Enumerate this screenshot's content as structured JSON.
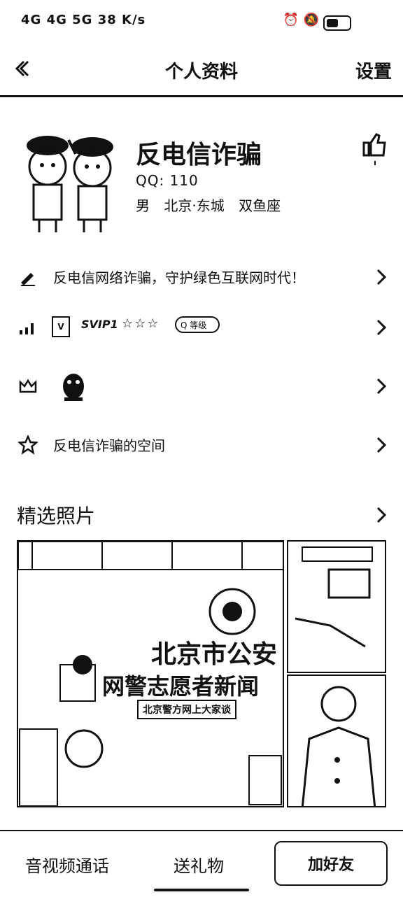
{
  "status_bar": {
    "left": "4G 4G 5G 38 K/s",
    "right": "⏰ 🔕",
    "battery_level": 0.6
  },
  "nav": {
    "back_icon": "chevron-left-icon",
    "title": "个人资料",
    "settings": "设置"
  },
  "profile": {
    "name": "反电信诈骗",
    "qq": "QQ: 110",
    "gender": "男",
    "location": "北京·东城",
    "zodiac": "双鱼座",
    "like_icon": "thumb-up-icon"
  },
  "rows": [
    {
      "icon": "pencil-icon",
      "text": "反电信网络诈骗，守护绿色互联网时代！"
    },
    {
      "icon": "level-icon",
      "vip": "SVIP1",
      "stars": "☆☆☆",
      "pill": "Q 等级"
    },
    {
      "icon": "crown-icon",
      "badge_icon": "qq-penguin-icon"
    },
    {
      "icon": "star-icon",
      "text": "反电信诈骗的空间"
    }
  ],
  "photos": {
    "title": "精选照片",
    "banner_line1": "北京市公安",
    "banner_line2": "网警志愿者新闻",
    "banner_line3": "北京警方网上大家谈"
  },
  "bottom": {
    "call": "音视频通话",
    "gift": "送礼物",
    "add": "加好友"
  },
  "colors": {
    "ink": "#111111",
    "bg": "#ffffff"
  }
}
